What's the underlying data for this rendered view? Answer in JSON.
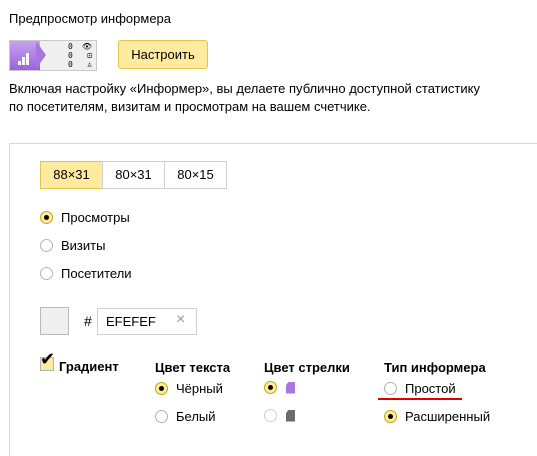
{
  "preview": {
    "title": "Предпросмотр информера",
    "informer_rows": [
      {
        "value": "0",
        "icon": "eye-icon",
        "glyph": "👁"
      },
      {
        "value": "0",
        "icon": "visits-icon",
        "glyph": "⊡"
      },
      {
        "value": "0",
        "icon": "user-icon",
        "glyph": "♙"
      }
    ],
    "configure_label": "Настроить"
  },
  "description": "Включая настройку «Информер», вы делаете публично доступной статистику по посетителям, визитам и просмотрам на вашем счетчике.",
  "sizes": [
    {
      "label": "88×31",
      "active": true
    },
    {
      "label": "80×31",
      "active": false
    },
    {
      "label": "80×15",
      "active": false
    }
  ],
  "metrics": [
    {
      "label": "Просмотры",
      "checked": true
    },
    {
      "label": "Визиты",
      "checked": false
    },
    {
      "label": "Посетители",
      "checked": false
    }
  ],
  "color": {
    "hash": "#",
    "value": "EFEFEF",
    "clear_glyph": "×",
    "swatch": "#efefef"
  },
  "gradient": {
    "label": "Градиент",
    "checked": true
  },
  "text_color": {
    "title": "Цвет текста",
    "options": [
      {
        "label": "Чёрный",
        "checked": true
      },
      {
        "label": "Белый",
        "checked": false
      }
    ]
  },
  "arrow_color": {
    "title": "Цвет стрелки",
    "options": [
      {
        "swatch": "#a976de",
        "checked": true
      },
      {
        "swatch": "#6b6b6b",
        "checked": false
      }
    ]
  },
  "informer_type": {
    "title": "Тип информера",
    "options": [
      {
        "label": "Простой",
        "checked": false
      },
      {
        "label": "Расширенный",
        "checked": true
      }
    ]
  },
  "colors": {
    "accent_yellow": "#ffeba0",
    "accent_border": "#e0c64f",
    "underline_red": "#e00000"
  }
}
